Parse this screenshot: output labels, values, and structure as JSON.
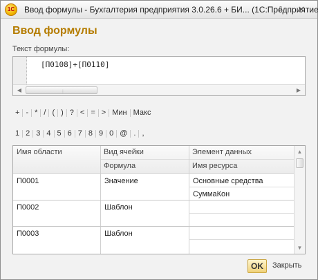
{
  "window": {
    "title": "Ввод формулы - Бухгалтерия предприятия 3.0.26.6 + БИ...  (1С:Предприятие)",
    "logo": "1С",
    "menu_icon": "⇩",
    "close_icon": "✕"
  },
  "page": {
    "title": "Ввод формулы",
    "formula_label": "Текст формулы:",
    "formula_text": "[П0108]+[П0110]"
  },
  "operators": [
    "+",
    "-",
    "*",
    "/",
    "(",
    ")",
    "?",
    "<",
    "=",
    ">",
    "Мин",
    "Макс"
  ],
  "digits": [
    "1",
    "2",
    "3",
    "4",
    "5",
    "6",
    "7",
    "8",
    "9",
    "0",
    "@",
    ".",
    ","
  ],
  "grid": {
    "headers": {
      "area_name": "Имя области",
      "cell_kind": "Вид ячейки",
      "formula": "Формула",
      "data_element": "Элемент данных",
      "resource_name": "Имя ресурса"
    },
    "rows": [
      {
        "area": "П0001",
        "kind": "Значение",
        "element": "Основные средства",
        "resource": "СуммаКон"
      },
      {
        "area": "П0002",
        "kind": "Шаблон",
        "element": "",
        "resource": ""
      },
      {
        "area": "П0003",
        "kind": "Шаблон",
        "element": "",
        "resource": ""
      }
    ]
  },
  "buttons": {
    "ok": "OK",
    "close": "Закрыть"
  }
}
